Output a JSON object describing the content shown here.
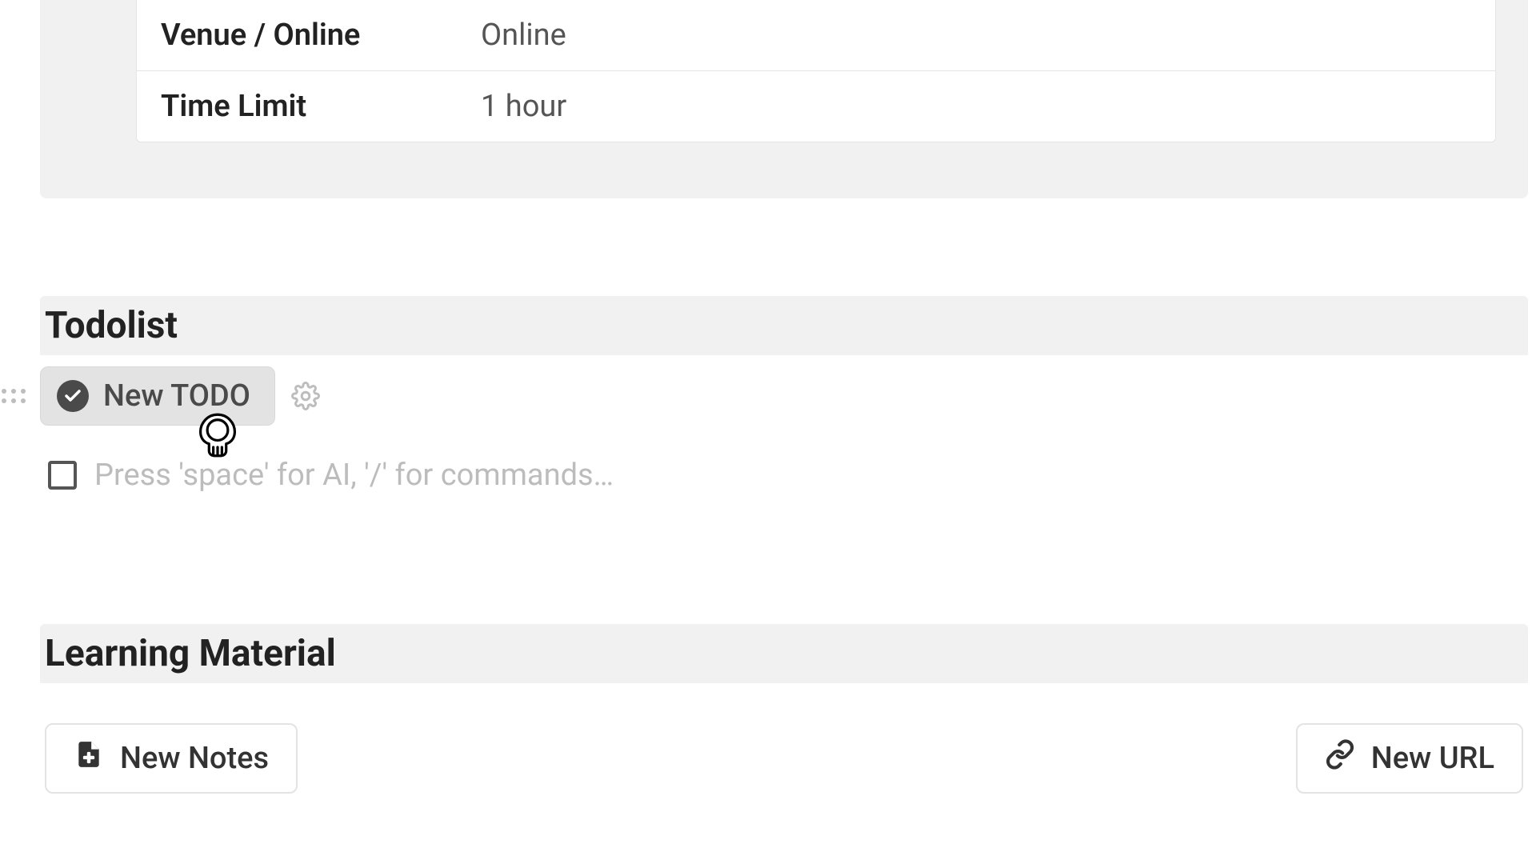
{
  "info": {
    "rows": [
      {
        "key": "Venue / Online",
        "val": "Online"
      },
      {
        "key": "Time Limit",
        "val": "1 hour"
      }
    ]
  },
  "todolist": {
    "header": "Todolist",
    "new_todo_label": "New TODO",
    "placeholder": "Press 'space' for AI, '/' for commands…"
  },
  "learning": {
    "header": "Learning Material",
    "new_notes_label": "New Notes",
    "new_url_label": "New URL"
  }
}
